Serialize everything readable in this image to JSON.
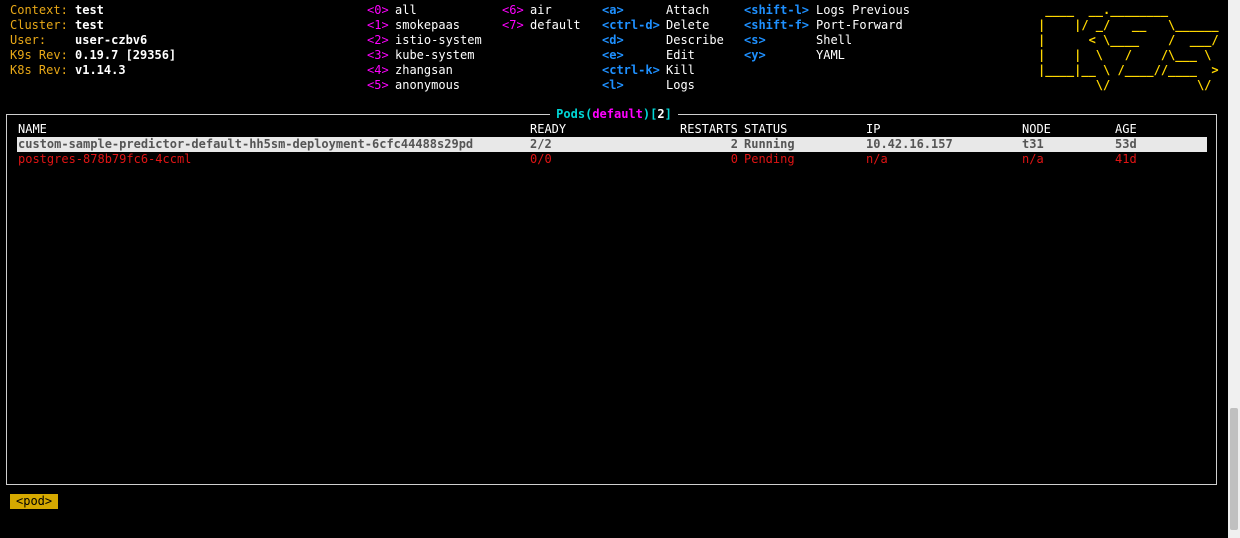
{
  "info": [
    {
      "key": "Context:",
      "value": "test"
    },
    {
      "key": "Cluster:",
      "value": "test"
    },
    {
      "key": "User:",
      "value": "user-czbv6"
    },
    {
      "key": "K9s Rev:",
      "value": "0.19.7 [29356]"
    },
    {
      "key": "K8s Rev:",
      "value": "v1.14.3"
    }
  ],
  "namespaces_col1": [
    {
      "key": "<0>",
      "label": "all"
    },
    {
      "key": "<1>",
      "label": "smokepaas"
    },
    {
      "key": "<2>",
      "label": "istio-system"
    },
    {
      "key": "<3>",
      "label": "kube-system"
    },
    {
      "key": "<4>",
      "label": "zhangsan"
    },
    {
      "key": "<5>",
      "label": "anonymous"
    }
  ],
  "namespaces_col2": [
    {
      "key": "<6>",
      "label": "air"
    },
    {
      "key": "<7>",
      "label": "default"
    }
  ],
  "hotkeys_col1": [
    {
      "key": "<a>",
      "label": "Attach"
    },
    {
      "key": "<ctrl-d>",
      "label": "Delete"
    },
    {
      "key": "<d>",
      "label": "Describe"
    },
    {
      "key": "<e>",
      "label": "Edit"
    },
    {
      "key": "<ctrl-k>",
      "label": "Kill"
    },
    {
      "key": "<l>",
      "label": "Logs"
    }
  ],
  "hotkeys_col2": [
    {
      "key": "<shift-l>",
      "label": "Logs Previous"
    },
    {
      "key": "<shift-f>",
      "label": "Port-Forward"
    },
    {
      "key": "<s>",
      "label": "Shell"
    },
    {
      "key": "<y>",
      "label": "YAML"
    }
  ],
  "logo_lines": [
    " ____  __.________       ",
    "|    |/ _/   __   \\______",
    "|      < \\____    /  ___/",
    "|    |  \\   /    /\\___ \\ ",
    "|____|__ \\ /____//____  >",
    "        \\/            \\/ "
  ],
  "table": {
    "title_resource": "Pods",
    "title_namespace": "default",
    "title_count": "2",
    "headers": {
      "name": "NAME",
      "ready": "READY",
      "restarts": "RESTARTS",
      "status": "STATUS",
      "ip": "IP",
      "node": "NODE",
      "age": "AGE"
    },
    "rows": [
      {
        "name": "custom-sample-predictor-default-hh5sm-deployment-6cfc44488s29pd",
        "ready": "2/2",
        "restarts": "2",
        "status": "Running",
        "ip": "10.42.16.157",
        "node": "t31",
        "age": "53d",
        "selected": true
      },
      {
        "name": "postgres-878b79fc6-4ccml",
        "ready": "0/0",
        "restarts": "0",
        "status": "Pending",
        "ip": "n/a",
        "node": "n/a",
        "age": "41d",
        "selected": false
      }
    ]
  },
  "breadcrumb": "<pod>",
  "colors": {
    "info_key": "#e8a817",
    "namespace_key": "#ff00ff",
    "hotkey_key": "#1e90ff",
    "logo": "#ffd700",
    "error_row": "#e01414",
    "selected_row_bg": "#e8e8e8",
    "crumb_bg": "#d6a900"
  }
}
